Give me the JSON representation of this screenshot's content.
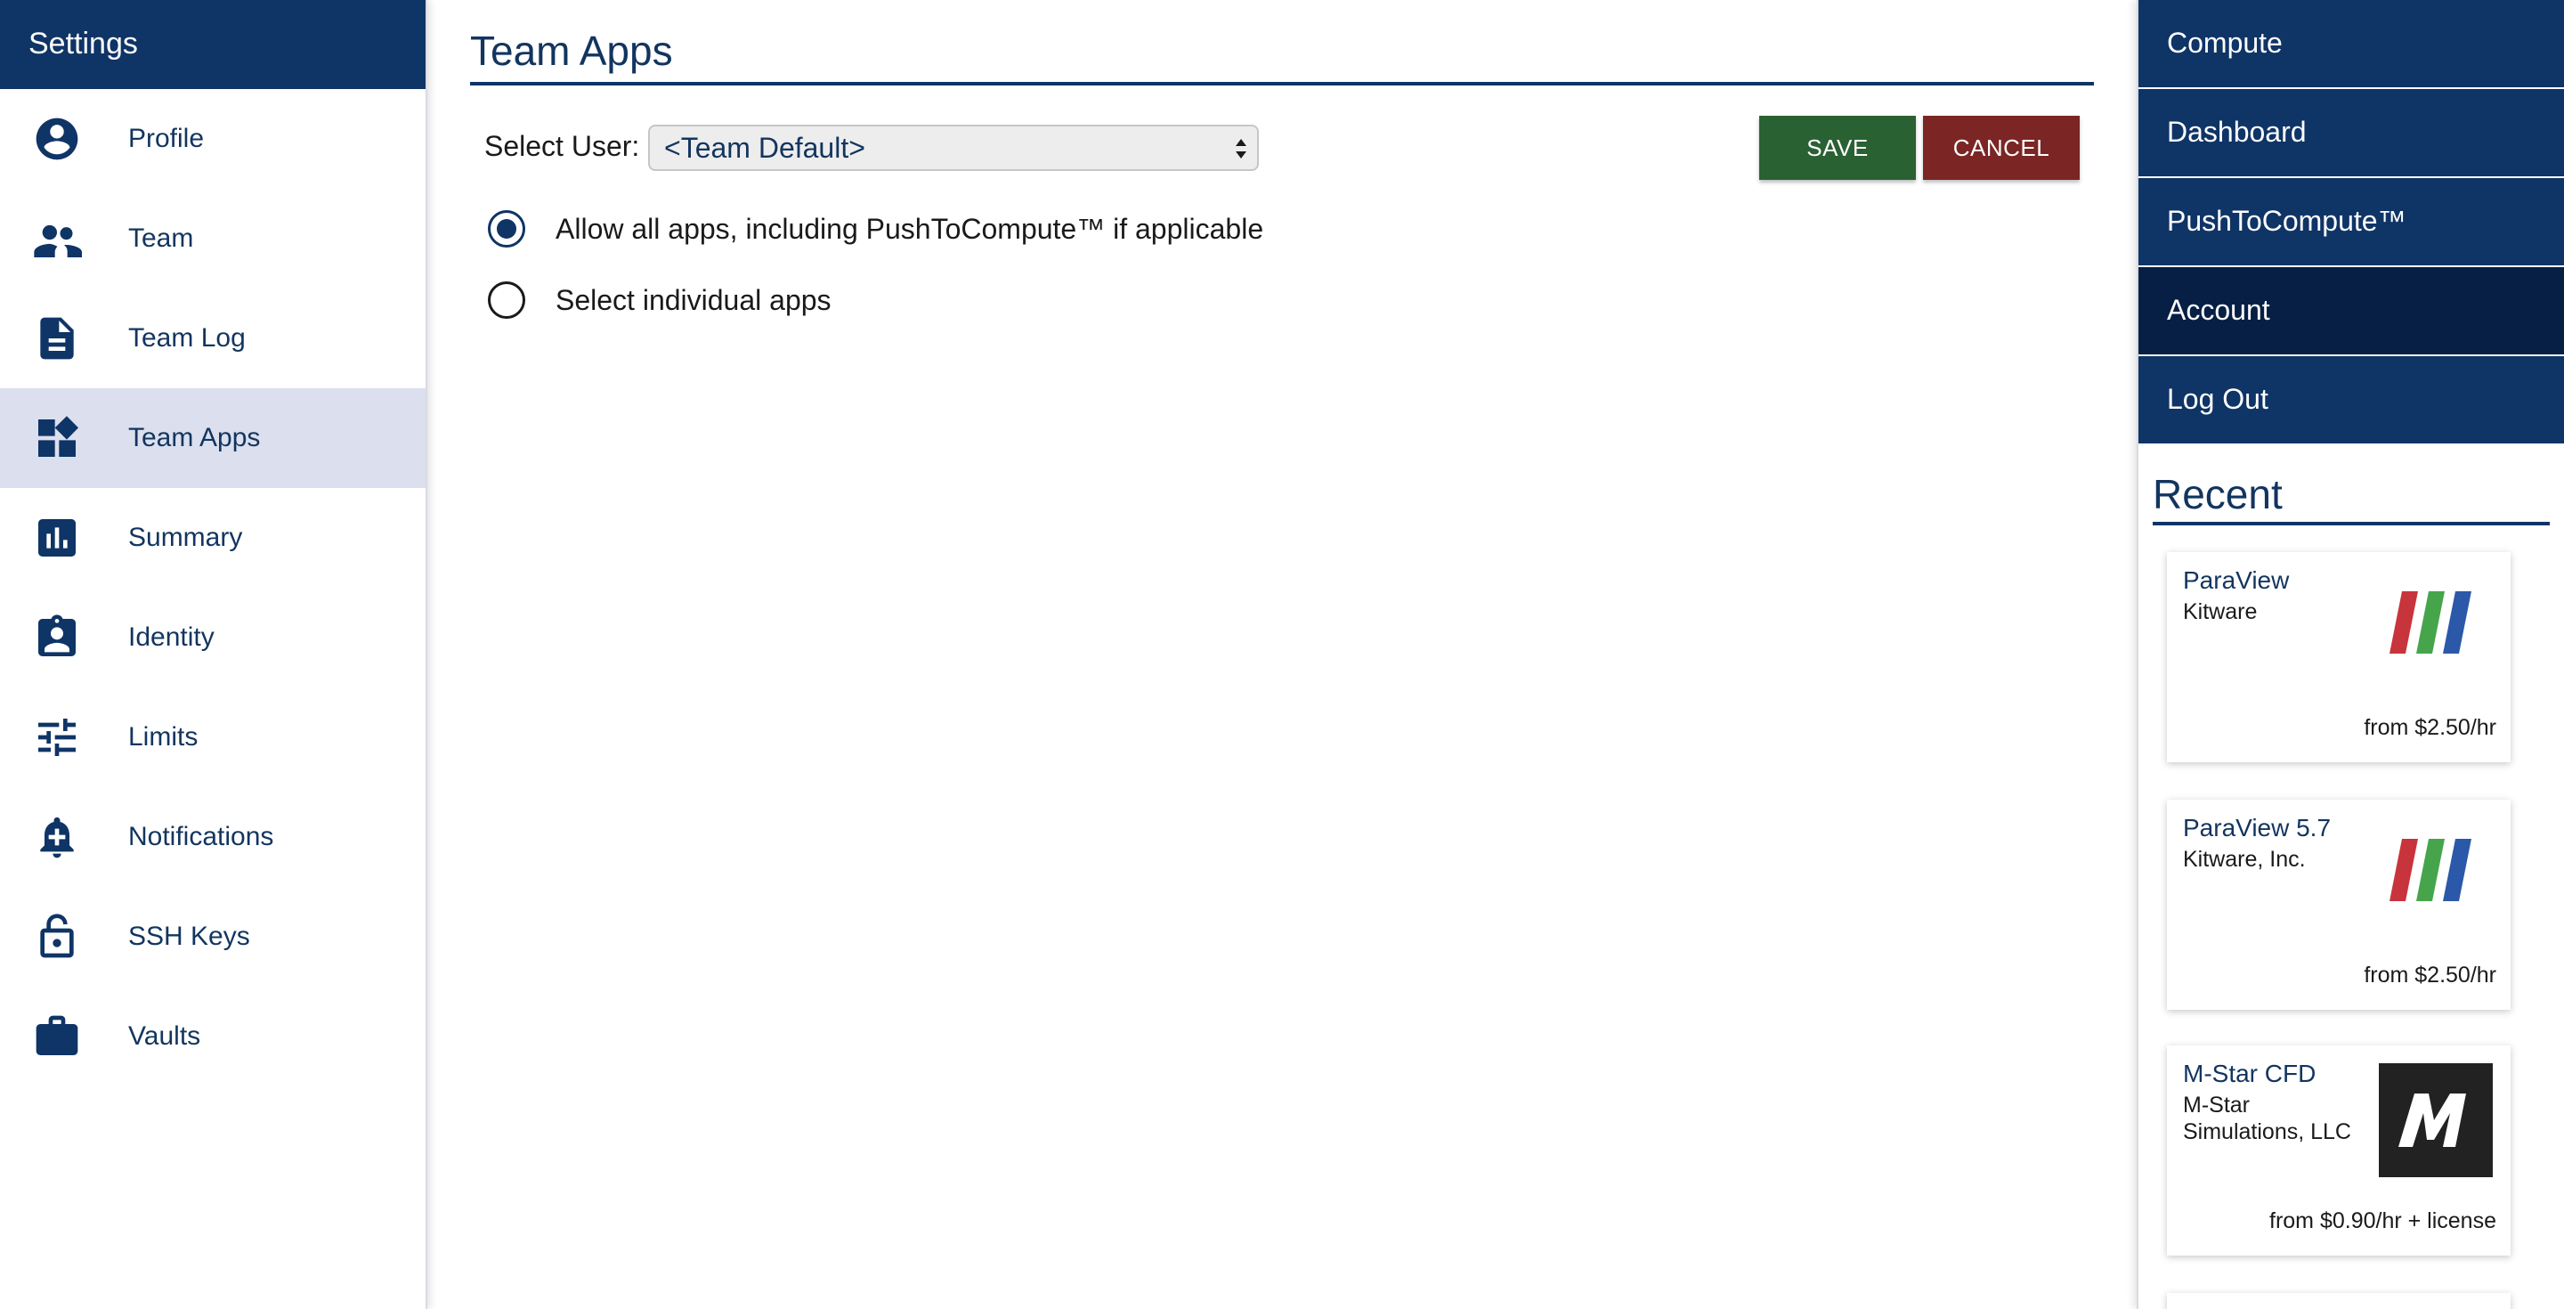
{
  "sidebar": {
    "title": "Settings",
    "items": [
      {
        "label": "Profile",
        "icon": "account-circle-icon"
      },
      {
        "label": "Team",
        "icon": "people-icon"
      },
      {
        "label": "Team Log",
        "icon": "document-icon"
      },
      {
        "label": "Team Apps",
        "icon": "widgets-icon",
        "active": true
      },
      {
        "label": "Summary",
        "icon": "bar-chart-icon"
      },
      {
        "label": "Identity",
        "icon": "badge-icon"
      },
      {
        "label": "Limits",
        "icon": "sliders-icon"
      },
      {
        "label": "Notifications",
        "icon": "bell-plus-icon"
      },
      {
        "label": "SSH Keys",
        "icon": "unlock-icon"
      },
      {
        "label": "Vaults",
        "icon": "briefcase-icon"
      }
    ]
  },
  "main": {
    "title": "Team Apps",
    "select_label": "Select User:",
    "select_value": "<Team Default>",
    "save_label": "SAVE",
    "cancel_label": "CANCEL",
    "options": [
      {
        "label": "Allow all apps, including PushToCompute™ if applicable",
        "selected": true
      },
      {
        "label": "Select individual apps",
        "selected": false
      }
    ]
  },
  "nav": {
    "items": [
      {
        "label": "Compute"
      },
      {
        "label": "Dashboard"
      },
      {
        "label": "PushToCompute™"
      },
      {
        "label": "Account",
        "active": true
      },
      {
        "label": "Log Out"
      }
    ]
  },
  "recent": {
    "title": "Recent",
    "cards": [
      {
        "name": "ParaView",
        "vendor": "Kitware",
        "price": "from $2.50/hr",
        "logo": "paraview-logo"
      },
      {
        "name": "ParaView 5.7",
        "vendor": "Kitware, Inc.",
        "price": "from $2.50/hr",
        "logo": "paraview-logo"
      },
      {
        "name": "M-Star CFD",
        "vendor": "M-Star Simulations, LLC",
        "price": "from $0.90/hr + license",
        "logo": "mstar-logo"
      }
    ]
  },
  "colors": {
    "brand": "#0f3466",
    "nav_active": "#071f45",
    "sidebar_active": "#dcdfee",
    "save": "#2a6133",
    "cancel": "#7b2624"
  }
}
